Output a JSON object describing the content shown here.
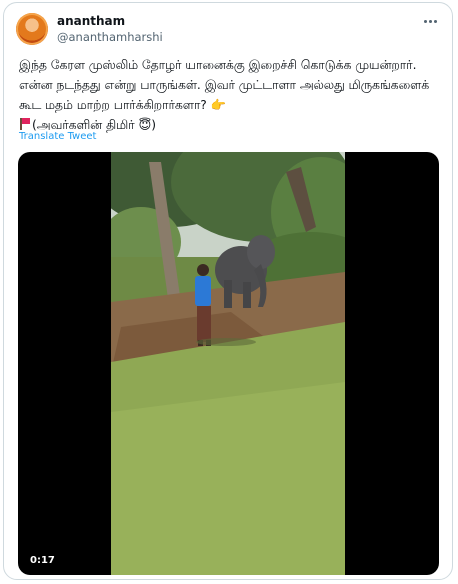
{
  "tweet": {
    "display_name": "anantham",
    "handle": "@ananthamharshi",
    "text_line1": "இந்த கேரள முஸ்லிம் தோழர் யானைக்கு இறைச்சி கொடுக்க முயன்றார். என்ன நடந்தது என்று பாருங்கள். இவர் முட்டாளா அல்லது மிருகங்களைக் கூட மதம் மாற்ற பார்க்கிறார்களா? 👉",
    "text_line2": "(அவர்களின் திமிர் 😇)",
    "translate_label": "Translate Tweet"
  },
  "media": {
    "duration": "0:17"
  },
  "icons": {
    "more": "more-horizontal-icon",
    "flag": "red-flag-icon"
  },
  "colors": {
    "link": "#1d9bf0",
    "secondary_text": "#536471",
    "border": "#cfd9de"
  }
}
